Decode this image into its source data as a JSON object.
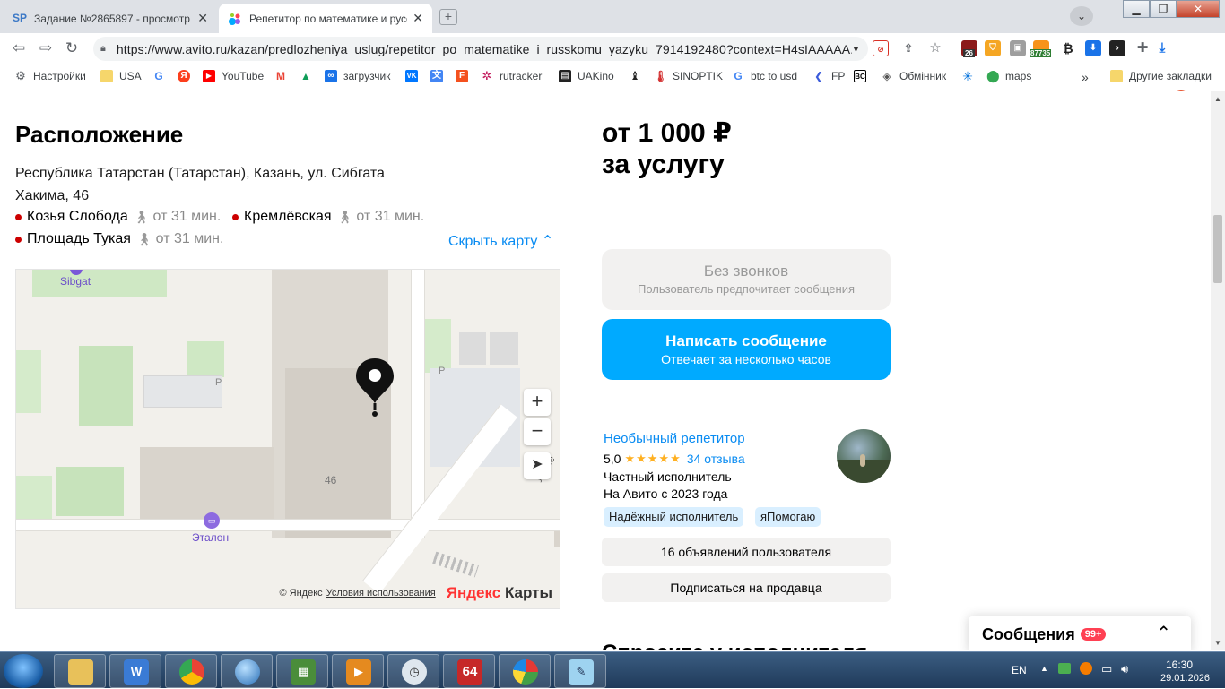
{
  "browser": {
    "tabs": [
      {
        "fav": "SP",
        "title": "Задание №2865897 - просмотр з",
        "close": "✕"
      },
      {
        "fav": "●",
        "title": "Репетитор по математике и русс",
        "close": "✕"
      }
    ],
    "new_tab": "+",
    "url": "https://www.avito.ru/kazan/predlozheniya_uslug/repetitor_po_matematike_i_russkomu_yazyku_7914192480?context=H4sIAAAAA...",
    "ext_counters": {
      "badge1": "26",
      "badge2": "87735"
    },
    "avatar_letter": "I",
    "bookmarks": [
      "Настройки",
      "USA",
      "YouTube",
      "загрузчик",
      "rutracker",
      "UAKino",
      "SINOPTIK",
      "btc to usd",
      "FP",
      "Обмінник",
      "maps",
      "Другие закладки"
    ],
    "bookmarks_more": "»"
  },
  "location": {
    "title": "Расположение",
    "address": "Республика Татарстан (Татарстан), Казань, ул. Сибгата Хакима, 46",
    "metro": [
      {
        "name": "Козья Слобода",
        "time": "от 31 мин."
      },
      {
        "name": "Кремлёвская",
        "time": "от 31 мин."
      },
      {
        "name": "Площадь Тукая",
        "time": "от 31 мин."
      }
    ],
    "hide_map": "Скрыть карту ⌃"
  },
  "map": {
    "labels": {
      "sibgat": "Sibgat",
      "etalon": "Эталон",
      "house": "46",
      "street": "ул. Ле",
      "parking": "P"
    },
    "zoom_in": "+",
    "zoom_out": "−",
    "attribution": "© Яндекс",
    "terms": "Условия использования",
    "brand_ya": "Яндекс",
    "brand_maps": "Карты"
  },
  "offer": {
    "price_line1": "от 1 000 ₽",
    "price_line2": "за услугу",
    "no_calls": {
      "title": "Без звонков",
      "subtitle": "Пользователь предпочитает сообщения"
    },
    "write": {
      "title": "Написать сообщение",
      "subtitle": "Отвечает за несколько часов"
    }
  },
  "seller": {
    "name": "Необычный репетитор",
    "rating": "5,0",
    "stars": "★★★★★",
    "reviews": "34 отзыва",
    "type": "Частный исполнитель",
    "since": "На Авито с 2023 года",
    "badges": [
      "Надёжный исполнитель",
      "яПомогаю"
    ],
    "listings": "16 объявлений пользователя",
    "subscribe": "Подписаться на продавца"
  },
  "messages_widget": {
    "label": "Сообщения",
    "count": "99+",
    "chevron": "⌃"
  },
  "cut_heading": "Спросите у исполнителя",
  "taskbar": {
    "lang": "EN",
    "time": "16:30",
    "date": "29.01.2026",
    "app64": "64"
  },
  "colors": {
    "accent": "#00aaff",
    "link": "#0a8cf2",
    "metro": "#cc0000",
    "star": "#ffb021"
  }
}
